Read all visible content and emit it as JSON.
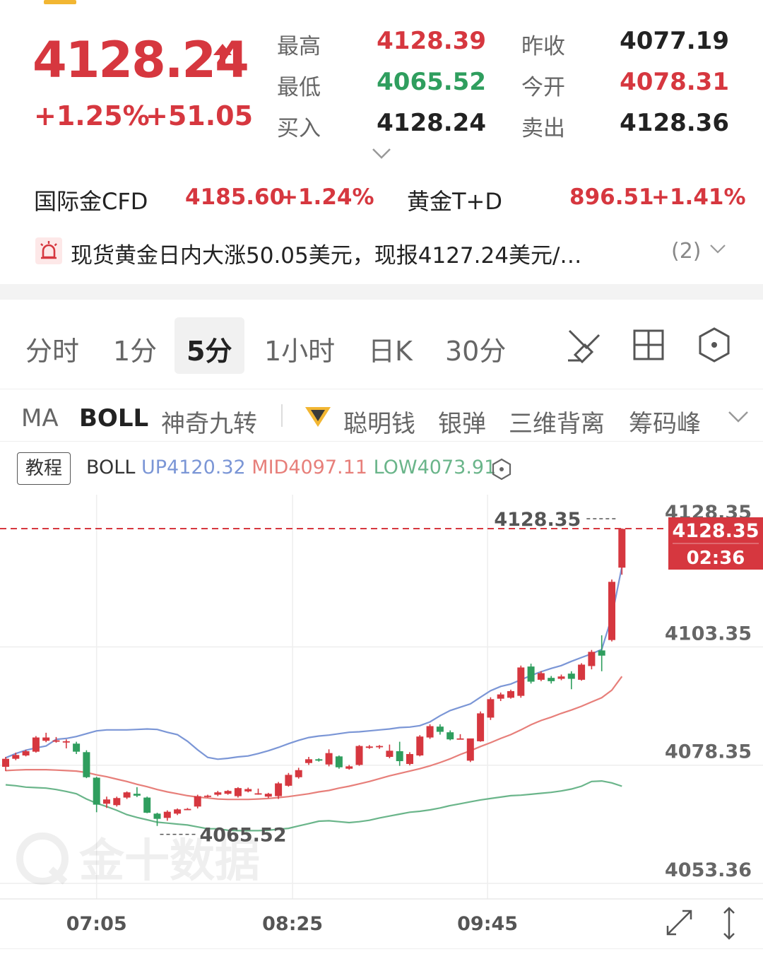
{
  "quote": {
    "price": "4128.24",
    "change_pct": "+1.25%",
    "change_abs": "+51.05",
    "stats": [
      {
        "label": "最高",
        "value": "4128.39",
        "color": "#d6373f"
      },
      {
        "label": "昨收",
        "value": "4077.19",
        "color": "#222222"
      },
      {
        "label": "最低",
        "value": "4065.52",
        "color": "#2f9e5e"
      },
      {
        "label": "今开",
        "value": "4078.31",
        "color": "#d6373f"
      },
      {
        "label": "买入",
        "value": "4128.24",
        "color": "#222222"
      },
      {
        "label": "卖出",
        "value": "4128.36",
        "color": "#222222"
      }
    ]
  },
  "related": [
    {
      "name": "国际金CFD",
      "price": "4185.60",
      "pct": "+1.24%"
    },
    {
      "name": "黄金T+D",
      "price": "896.51",
      "pct": "+1.41%"
    }
  ],
  "news": {
    "text": "现货黄金日内大涨50.05美元，现报4127.24美元/…",
    "count": "(2)"
  },
  "period_tabs": [
    "分时",
    "1分",
    "5分",
    "1小时",
    "日K",
    "30分"
  ],
  "active_period": "5分",
  "indicators": [
    "MA",
    "BOLL",
    "神奇九转",
    "聪明钱",
    "银弹",
    "三维背离",
    "筹码峰"
  ],
  "active_indicator": "BOLL",
  "legend": {
    "tutorial": "教程",
    "name": "BOLL",
    "up": "UP4120.32",
    "mid": "MID4097.11",
    "low": "LOW4073.91"
  },
  "chart_data": {
    "type": "candlestick",
    "y_ticks": [
      "4128.35",
      "4103.35",
      "4078.35",
      "4053.36"
    ],
    "ylim": [
      4053.36,
      4128.35
    ],
    "x_ticks": [
      "07:05",
      "08:25",
      "09:45"
    ],
    "current_price": "4128.35",
    "countdown": "02:36",
    "high_label": "4128.35",
    "low_label": "4065.52",
    "watermark": "金十数据",
    "colors": {
      "up": "#d6373f",
      "down": "#2f9e5e",
      "boll_up": "#7b96d6",
      "boll_mid": "#e77f7a",
      "boll_low": "#6ab58a"
    },
    "candles": [
      [
        4078.0,
        4079.7,
        4077.1,
        4080.1
      ],
      [
        4079.7,
        4080.5,
        4079.4,
        4081.0
      ],
      [
        4080.4,
        4081.3,
        4080.2,
        4081.6
      ],
      [
        4081.2,
        4084.2,
        4081.0,
        4084.5
      ],
      [
        4083.5,
        4084.2,
        4083.2,
        4085.2
      ],
      [
        4083.3,
        4083.6,
        4083.1,
        4084.3
      ],
      [
        4083.2,
        4083.4,
        4081.9,
        4083.8
      ],
      [
        4082.9,
        4081.2,
        4080.7,
        4083.3
      ],
      [
        4081.1,
        4075.8,
        4075.6,
        4081.5
      ],
      [
        4075.7,
        4070.0,
        4068.4,
        4075.9
      ],
      [
        4070.2,
        4071.1,
        4069.3,
        4071.7
      ],
      [
        4069.9,
        4071.4,
        4069.6,
        4071.7
      ],
      [
        4071.5,
        4072.6,
        4071.2,
        4072.8
      ],
      [
        4072.3,
        4071.9,
        4071.6,
        4073.7
      ],
      [
        4071.5,
        4068.3,
        4068.2,
        4071.7
      ],
      [
        4068.1,
        4067.0,
        4065.5,
        4068.3
      ],
      [
        4067.2,
        4068.5,
        4066.6,
        4068.8
      ],
      [
        4068.1,
        4069.0,
        4067.8,
        4069.2
      ],
      [
        4069.1,
        4069.1,
        4068.9,
        4069.3
      ],
      [
        4069.6,
        4071.8,
        4069.2,
        4072.1
      ],
      [
        4071.7,
        4071.9,
        4071.5,
        4072.1
      ],
      [
        4072.1,
        4072.6,
        4071.8,
        4072.9
      ],
      [
        4072.3,
        4072.9,
        4072.1,
        4073.1
      ],
      [
        4071.8,
        4073.5,
        4071.5,
        4073.7
      ],
      [
        4072.8,
        4073.3,
        4072.6,
        4073.6
      ],
      [
        4072.4,
        4072.4,
        4072.1,
        4073.4
      ],
      [
        4071.7,
        4072.3,
        4071.4,
        4072.5
      ],
      [
        4071.8,
        4074.5,
        4071.2,
        4074.8
      ],
      [
        4074.0,
        4076.3,
        4073.8,
        4076.7
      ],
      [
        4075.8,
        4077.3,
        4075.5,
        4077.8
      ],
      [
        4078.8,
        4079.6,
        4078.4,
        4080.1
      ],
      [
        4079.6,
        4079.3,
        4079.1,
        4079.8
      ],
      [
        4078.5,
        4080.9,
        4078.1,
        4081.7
      ],
      [
        4080.2,
        4077.9,
        4077.6,
        4080.4
      ],
      [
        4077.6,
        4078.1,
        4077.4,
        4078.4
      ],
      [
        4078.4,
        4082.4,
        4078.2,
        4082.6
      ],
      [
        4082.0,
        4082.3,
        4081.8,
        4082.6
      ],
      [
        4082.4,
        4082.4,
        4081.8,
        4082.6
      ],
      [
        4080.1,
        4081.4,
        4079.8,
        4082.7
      ],
      [
        4081.3,
        4079.2,
        4078.2,
        4083.3
      ],
      [
        4078.6,
        4080.7,
        4078.3,
        4081.1
      ],
      [
        4080.4,
        4084.4,
        4080.2,
        4084.7
      ],
      [
        4084.2,
        4086.6,
        4083.9,
        4087.0
      ],
      [
        4086.5,
        4085.4,
        4084.8,
        4087.0
      ],
      [
        4085.3,
        4083.8,
        4083.6,
        4085.7
      ],
      [
        4084.0,
        4084.0,
        4083.8,
        4084.9
      ],
      [
        4079.3,
        4084.0,
        4079.0,
        4083.6
      ],
      [
        4083.4,
        4089.3,
        4083.3,
        4089.7
      ],
      [
        4088.4,
        4092.3,
        4087.9,
        4092.7
      ],
      [
        4092.4,
        4093.3,
        4091.9,
        4093.7
      ],
      [
        4092.6,
        4094.0,
        4092.4,
        4094.3
      ],
      [
        4093.0,
        4099.0,
        4092.6,
        4099.4
      ],
      [
        4099.2,
        4096.0,
        4095.6,
        4099.8
      ],
      [
        4096.4,
        4097.8,
        4096.1,
        4098.2
      ],
      [
        4096.8,
        4096.1,
        4095.6,
        4097.2
      ],
      [
        4096.6,
        4097.1,
        4096.3,
        4097.5
      ],
      [
        4097.7,
        4096.6,
        4094.4,
        4098.2
      ],
      [
        4096.4,
        4099.6,
        4096.2,
        4099.9
      ],
      [
        4099.3,
        4102.3,
        4098.6,
        4102.7
      ],
      [
        4102.6,
        4101.5,
        4098.2,
        4105.8
      ],
      [
        4104.8,
        4117.1,
        4104.5,
        4117.6
      ],
      [
        4120.1,
        4128.3,
        4118.6,
        4128.4
      ]
    ],
    "boll_up": [
      4079.9,
      4080.8,
      4081.5,
      4082.0,
      4082.4,
      4083.8,
      4084.0,
      4084.4,
      4085.0,
      4085.6,
      4085.8,
      4085.8,
      4085.8,
      4085.9,
      4086.0,
      4085.9,
      4085.3,
      4084.8,
      4083.4,
      4081.6,
      4080.0,
      4079.6,
      4079.8,
      4080.1,
      4080.3,
      4080.8,
      4081.4,
      4082.1,
      4082.9,
      4083.6,
      4084.2,
      4084.5,
      4084.7,
      4085.0,
      4085.3,
      4085.4,
      4085.6,
      4085.8,
      4086.0,
      4086.3,
      4086.4,
      4086.7,
      4087.5,
      4088.8,
      4089.9,
      4090.6,
      4091.3,
      4092.7,
      4094.1,
      4095.0,
      4095.5,
      4096.4,
      4097.3,
      4098.1,
      4098.8,
      4099.4,
      4100.3,
      4101.1,
      4101.9,
      4102.8,
      4109.7,
      4120.3
    ],
    "boll_mid": [
      4077.2,
      4077.3,
      4077.4,
      4077.4,
      4077.4,
      4077.3,
      4077.2,
      4077.1,
      4076.8,
      4076.3,
      4075.9,
      4075.4,
      4074.9,
      4074.3,
      4073.8,
      4073.2,
      4072.7,
      4072.3,
      4071.9,
      4071.6,
      4071.4,
      4071.2,
      4071.1,
      4071.1,
      4071.1,
      4071.2,
      4071.3,
      4071.5,
      4071.7,
      4072.0,
      4072.3,
      4072.7,
      4073.0,
      4073.5,
      4073.9,
      4074.4,
      4074.9,
      4075.5,
      4076.1,
      4076.6,
      4077.1,
      4077.6,
      4078.2,
      4078.9,
      4079.7,
      4080.6,
      4081.4,
      4082.3,
      4083.1,
      4084.0,
      4084.8,
      4085.8,
      4086.9,
      4087.8,
      4088.5,
      4089.3,
      4090.0,
      4090.8,
      4091.7,
      4092.6,
      4094.2,
      4097.1
    ],
    "boll_low": [
      4074.2,
      4074.0,
      4073.7,
      4073.6,
      4073.5,
      4073.2,
      4072.8,
      4072.3,
      4071.2,
      4070.3,
      4069.6,
      4068.8,
      4067.9,
      4067.3,
      4066.8,
      4066.3,
      4066.1,
      4065.9,
      4065.7,
      4065.3,
      4064.9,
      4064.9,
      4064.6,
      4064.5,
      4064.5,
      4064.5,
      4064.6,
      4064.8,
      4065.0,
      4065.5,
      4066.0,
      4066.5,
      4066.6,
      4066.4,
      4066.2,
      4066.4,
      4066.7,
      4067.2,
      4067.6,
      4068.0,
      4068.4,
      4068.6,
      4068.9,
      4069.3,
      4069.8,
      4070.2,
      4070.6,
      4071.0,
      4071.3,
      4071.6,
      4071.9,
      4072.0,
      4072.2,
      4072.4,
      4072.6,
      4072.9,
      4073.3,
      4073.9,
      4074.9,
      4075.0,
      4074.6,
      4073.9
    ]
  }
}
